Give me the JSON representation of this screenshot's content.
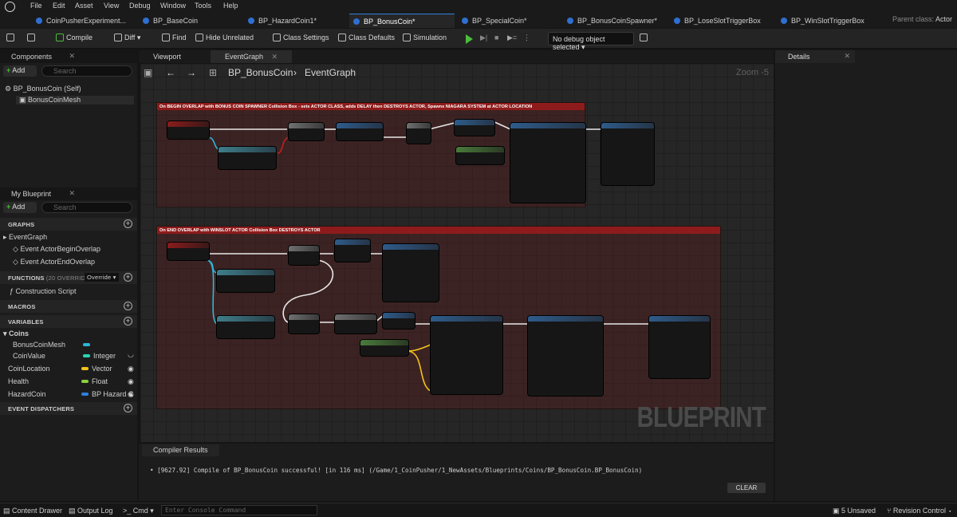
{
  "menubar": {
    "items": [
      "File",
      "Edit",
      "Asset",
      "View",
      "Debug",
      "Window",
      "Tools",
      "Help"
    ]
  },
  "tabs": [
    {
      "label": "CoinPusherExperiment...",
      "active": false
    },
    {
      "label": "BP_BaseCoin",
      "active": false
    },
    {
      "label": "BP_HazardCoin1*",
      "active": false
    },
    {
      "label": "BP_BonusCoin*",
      "active": true
    },
    {
      "label": "BP_SpecialCoin*",
      "active": false
    },
    {
      "label": "BP_BonusCoinSpawner*",
      "active": false
    },
    {
      "label": "BP_LoseSlotTriggerBox",
      "active": false
    },
    {
      "label": "BP_WinSlotTriggerBox",
      "active": false
    }
  ],
  "parent_class": {
    "label": "Parent class:",
    "value": "Actor"
  },
  "toolbar": {
    "compile": "Compile",
    "diff": "Diff",
    "find": "Find",
    "hide_unrelated": "Hide Unrelated",
    "class_settings": "Class Settings",
    "class_defaults": "Class Defaults",
    "simulation": "Simulation",
    "debug_object": "No debug object selected"
  },
  "components": {
    "title": "Components",
    "add": "Add",
    "search_placeholder": "Search",
    "items": [
      "BP_BonusCoin (Self)",
      "BonusCoinMesh"
    ]
  },
  "my_blueprint": {
    "title": "My Blueprint",
    "add": "Add",
    "search_placeholder": "Search",
    "graphs_header": "GRAPHS",
    "event_graph": "EventGraph",
    "events": [
      "Event ActorBeginOverlap",
      "Event ActorEndOverlap"
    ],
    "functions_header": "FUNCTIONS",
    "functions_count": "(20 OVERRIDABLE)",
    "override_label": "Override",
    "functions": [
      "Construction Script"
    ],
    "macros_header": "MACROS",
    "variables_header": "VARIABLES",
    "variable_category": "Coins",
    "variables": [
      {
        "name": "BonusCoinMesh",
        "type": "",
        "color": "#2fb5d8"
      },
      {
        "name": "CoinValue",
        "type": "Integer",
        "color": "#26d6b2"
      },
      {
        "name": "CoinLocation",
        "type": "Vector",
        "color": "#f2c21b"
      },
      {
        "name": "Health",
        "type": "Float",
        "color": "#8ad13d"
      },
      {
        "name": "HazardCoin",
        "type": "BP Hazard C",
        "color": "#2f7fe0"
      }
    ],
    "dispatchers_header": "EVENT DISPATCHERS"
  },
  "graph_tabs": [
    "Viewport",
    "EventGraph"
  ],
  "breadcrumb": {
    "blueprint": "BP_BonusCoin",
    "graph": "EventGraph"
  },
  "zoom": "Zoom -5",
  "watermark": "BLUEPRINT",
  "comments": [
    "On BEGIN OVERLAP with BONUS COIN SPAWNER Collision Box - sets ACTOR CLASS, adds DELAY then DESTROYS ACTOR, Spawns NIAGARA SYSTEM at ACTOR LOCATION",
    "On END OVERLAP with WINSLOT ACTOR Collision Box DESTROYS ACTOR"
  ],
  "compiler": {
    "title": "Compiler Results",
    "message": "[9627.92] Compile of BP_BonusCoin successful! [in 116 ms] (/Game/1_CoinPusher/1_NewAssets/Blueprints/Coins/BP_BonusCoin.BP_BonusCoin)",
    "clear": "CLEAR"
  },
  "details": {
    "title": "Details"
  },
  "statusbar": {
    "content_drawer": "Content Drawer",
    "output_log": "Output Log",
    "cmd": "Cmd",
    "console_placeholder": "Enter Console Command",
    "unsaved": "5 Unsaved",
    "revision_control": "Revision Control"
  }
}
